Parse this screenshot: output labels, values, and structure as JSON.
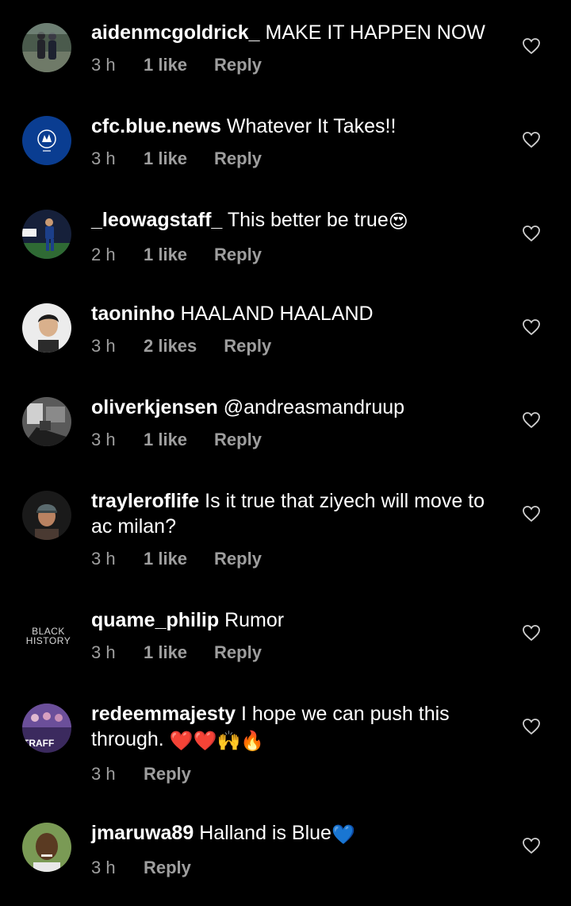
{
  "comments": [
    {
      "username": "aidenmcgoldrick_",
      "text": "MAKE IT HAPPEN NOW",
      "time": "3 h",
      "likes": "1 like",
      "reply": "Reply",
      "avatar": "photo-two-people-icon"
    },
    {
      "username": "cfc.blue.news",
      "text": "Whatever It Takes!!",
      "time": "3 h",
      "likes": "1 like",
      "reply": "Reply",
      "avatar": "chelsea-crest-icon"
    },
    {
      "username": "_leowagstaff_",
      "text": "This better be true",
      "emoji": "😍",
      "time": "2 h",
      "likes": "1 like",
      "reply": "Reply",
      "avatar": "photo-football-player-icon"
    },
    {
      "username": "taoninho",
      "text": "HAALAND HAALAND",
      "time": "3 h",
      "likes": "2 likes",
      "reply": "Reply",
      "avatar": "photo-portrait-icon"
    },
    {
      "username": "oliverkjensen",
      "text": "@andreasmandruup",
      "time": "3 h",
      "likes": "1 like",
      "reply": "Reply",
      "avatar": "photo-grayscale-room-icon"
    },
    {
      "username": "trayleroflife",
      "text": "Is it true that ziyech will move to ac milan?",
      "time": "3 h",
      "likes": "1 like",
      "reply": "Reply",
      "avatar": "photo-man-cap-icon"
    },
    {
      "username": "quame_philip",
      "text": "Rumor",
      "time": "3 h",
      "likes": "1 like",
      "reply": "Reply",
      "avatar_text_line1": "BLACK",
      "avatar_text_line2": "HISTORY"
    },
    {
      "username": "redeemmajesty",
      "text": "I hope we can push this through.",
      "emoji": "❤️❤️🙌🔥",
      "time": "3 h",
      "reply": "Reply",
      "avatar": "photo-traffic-poster-icon",
      "avatar_label": "TRAFF"
    },
    {
      "username": "jmaruwa89",
      "text": "Halland is Blue",
      "emoji": "💙",
      "time": "3 h",
      "reply": "Reply",
      "avatar": "photo-man-smiling-icon"
    }
  ],
  "colors": {
    "background": "#000000",
    "text_primary": "#ffffff",
    "text_secondary": "#9e9e9e",
    "heart_outline": "#cfcfcf"
  }
}
